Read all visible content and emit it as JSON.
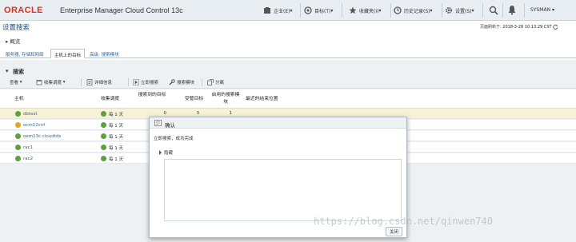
{
  "app": {
    "brand": "ORACLE",
    "product": "Enterprise Manager Cloud Control 13c"
  },
  "nav": {
    "enterprise": "企业(E)",
    "targets": "目标(T)",
    "favorites": "收藏夹(I)",
    "history": "历史记录(S)",
    "settings": "设置(S)",
    "user": "SYSMAN"
  },
  "page": {
    "title": "设置搜索",
    "refresh_label": "页面刷新于:",
    "refresh_time": "2018-3-28 10:13:29 CST",
    "overview": "概览"
  },
  "tabs": [
    {
      "label": "服务器, 存储和网络"
    },
    {
      "label": "主机上的目标"
    },
    {
      "label": "高级: 搜索模块"
    }
  ],
  "section": {
    "title": "搜索"
  },
  "toolbar": {
    "view": "查看",
    "collection_adjust": "收集调度",
    "refresh_details": "详细信息",
    "search_now": "立即搜索",
    "search_modules": "搜索模块",
    "detach": "分离"
  },
  "table": {
    "headers": [
      "主机",
      "收集调度",
      "搜索到的目标",
      "受管目标",
      "启用的搜索模块",
      "最近的结束位置"
    ],
    "rows": [
      {
        "host": "dbtest",
        "schedule": "每 1 天",
        "discovered": "0",
        "managed": "3",
        "modules": "1",
        "status": "green"
      },
      {
        "host": "ocm12cnf",
        "schedule": "每 1 天",
        "discovered": "",
        "managed": "",
        "modules": "",
        "status": "yellow"
      },
      {
        "host": "oem13c.cloudtds",
        "schedule": "每 1 天",
        "discovered": "",
        "managed": "",
        "modules": "",
        "status": "green"
      },
      {
        "host": "rac1",
        "schedule": "每 1 天",
        "discovered": "",
        "managed": "",
        "modules": "",
        "status": "green"
      },
      {
        "host": "rac2",
        "schedule": "每 1 天",
        "discovered": "",
        "managed": "",
        "modules": "",
        "status": "green"
      }
    ]
  },
  "dialog": {
    "title": "确认",
    "message": "立即搜索，成功完成",
    "hide": "隐藏",
    "close": "关闭"
  },
  "watermark": "https://blog.csdn.net/qinwen740",
  "colors": {
    "brand": "#e0301e",
    "title": "#1b4f8a",
    "link": "#2c67a3",
    "ok": "#5aa33a",
    "warn": "#e3a31f"
  }
}
